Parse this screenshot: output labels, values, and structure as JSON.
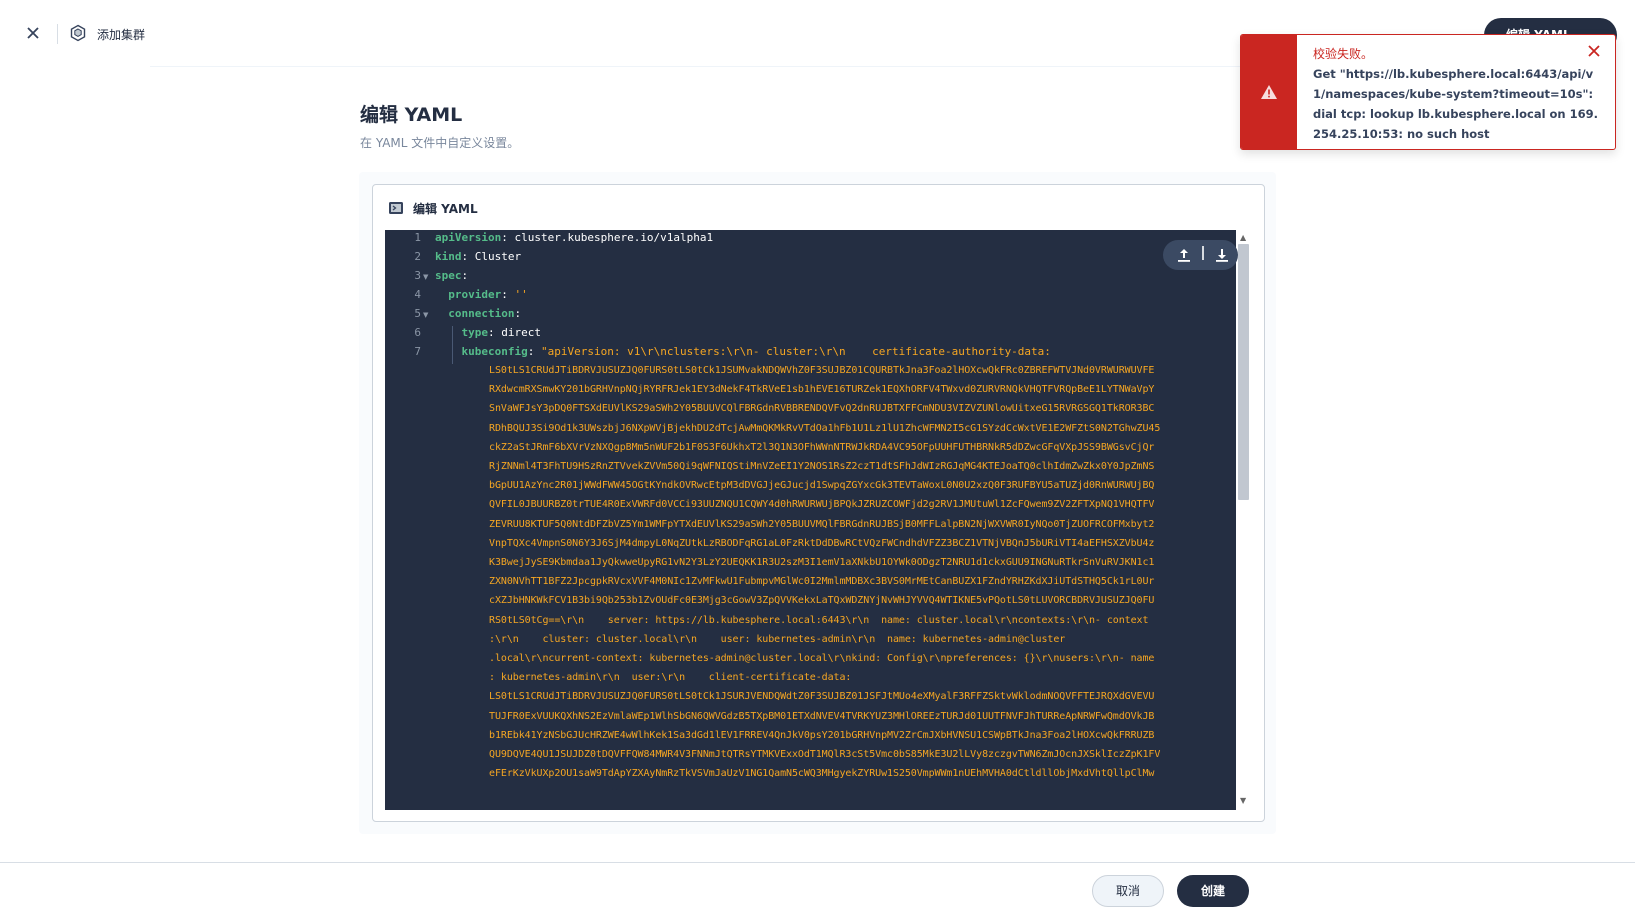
{
  "header": {
    "crumb": "添加集群",
    "edit_yaml_button": "编辑 YAML"
  },
  "page": {
    "title": "编辑 YAML",
    "subtitle": "在 YAML 文件中自定义设置。"
  },
  "editor": {
    "label": "编辑 YAML",
    "line_numbers": [
      "1",
      "2",
      "3",
      "4",
      "5",
      "6",
      "7"
    ],
    "lines": [
      {
        "key": "apiVersion",
        "sep": ": ",
        "val": "cluster.kubesphere.io/v1alpha1",
        "indent": ""
      },
      {
        "key": "kind",
        "sep": ": ",
        "val": "Cluster",
        "indent": ""
      },
      {
        "key": "spec",
        "sep": ":",
        "val": "",
        "indent": ""
      },
      {
        "key": "provider",
        "sep": ": ",
        "val": "''",
        "indent": "  "
      },
      {
        "key": "connection",
        "sep": ":",
        "val": "",
        "indent": "  "
      },
      {
        "key": "type",
        "sep": ": ",
        "val": "direct",
        "indent": "    "
      },
      {
        "key": "kubeconfig",
        "sep": ": ",
        "val": "\"apiVersion: v1\\r\\nclusters:\\r\\n- cluster:\\r\\n    certificate-authority-data:",
        "indent": "    "
      }
    ],
    "wrapped": [
      "LS0tLS1CRUdJTiBDRVJUSUZJQ0FURS0tLS0tCk1JSUMvakNDQWVhZ0F3SUJBZ01CQURBTkJna3Foa2lHOXcwQkFRc0ZBREFWTVJNd0VRWURWUVFE",
      "RXdwcmRXSmwKY201bGRHVnpNQjRYRFRJek1EY3dNekF4TkRVeE1sb1hEVE16TURZek1EQXhORFV4TWxvd0ZURVRNQkVHQTFVRQpBeE1LYTNWaVpY",
      "SnVaWFJsY3pDQ0FTSXdEUVlKS29aSWh2Y05BUUVCQlFBRGdnRVBBRENDQVFvQ2dnRUJBTXFFCmNDU3VIZVZUNlowUitxeG15RVRGSGQ1TkROR3BC",
      "RDhBQUJ3Si9Od1k3UWszbjJ6NXpWVjBjekhDU2dTcjAwMmQKMkRvVTdOa1hFb1U1Lz1lU1ZhcWFMN2I5cG1SYzdCcWxtVE1E2WFZtS0N2TGhwZU45",
      "ckZ2aStJRmF6bXVrVzNXQgpBMm5nWUF2b1F0S3F6UkhxT2l3Q1N3OFhWWnNTRWJkRDA4VC95OFpUUHFUTHBRNkR5dDZwcGFqVXpJSS9BWGsvCjQr",
      "RjZNNml4T3FhTU9HSzRnZTVvekZVVm50Qi9qWFNIQStiMnVZeEI1Y2NOS1RsZ2czT1dtSFhJdWIzRGJqMG4KTEJoaTQ0clhIdmZwZkx0Y0JpZmNS",
      "bGpUU1AzYnc2R01jWWdFWW45OGtKYndkOVRwcEtpM3dDVGJjeGJucjd1SwpqZGYxcGk3TEVTaWoxL0N0U2xzQ0F3RUFBYU5aTUZjd0RnWURWUjBQ",
      "QVFIL0JBUURBZ0trTUE4R0ExVWRFd0VCCi93UUZNQU1CQWY4d0hRWURWUjBPQkJZRUZCOWFjd2g2RV1JMUtuWl1ZcFQwem9ZV2ZFTXpNQ1VHQTFV",
      "ZEVRUU8KTUF5Q0NtdDFZbVZ5Ym1WMFpYTXdEUVlKS29aSWh2Y05BUUVMQlFBRGdnRUJBSjB0MFFLalpBN2NjWXVWR0IyNQo0TjZUOFRCOFMxbyt2",
      "VnpTQXc4VmpnS0N6Y3J6SjM4dmpyL0NqZUtkLzRBODFqRG1aL0FzRktDdDBwRCtVQzFWCndhdVFZZ3BCZ1VTNjVBQnJ5bURiVTI4aEFHSXZVbU4z",
      "K3BwejJySE9Kbmdaa1JyQkwweUpyRG1vN2Y3LzY2UEQKK1R3U2szM3I1emV1aXNkbU1OYWk0ODgzT2NRU1d1ckxGUU9INGNuRTkrSnVuRVJKN1c1",
      "ZXN0NVhTT1BFZ2JpcgpkRVcxVVF4M0NIc1ZvMFkwU1FubmpvMGlWc0I2MmlmMDBXc3BVS0MrMEtCanBUZX1FZndYRHZKdXJiUTdSTHQ5Ck1rL0Ur",
      "cXZJbHNKWkFCV1B3bi9Qb253b1ZvOUdFc0E3Mjg3cGowV3ZpQVVKekxLaTQxWDZNYjNvWHJYVVQ4WTIKNE5vPQotLS0tLUVORCBDRVJUSUZJQ0FU",
      "RS0tLS0tCg==\\r\\n    server: https://lb.kubesphere.local:6443\\r\\n  name: cluster.local\\r\\ncontexts:\\r\\n- context",
      ":\\r\\n    cluster: cluster.local\\r\\n    user: kubernetes-admin\\r\\n  name: kubernetes-admin@cluster",
      ".local\\r\\ncurrent-context: kubernetes-admin@cluster.local\\r\\nkind: Config\\r\\npreferences: {}\\r\\nusers:\\r\\n- name",
      ": kubernetes-admin\\r\\n  user:\\r\\n    client-certificate-data:",
      "LS0tLS1CRUdJTiBDRVJUSUZJQ0FURS0tLS0tCk1JSURJVENDQWdtZ0F3SUJBZ01JSFJtMUo4eXMyalF3RFFZSktvWklodmNOQVFFTEJRQXdGVEVU",
      "TUJFR0ExVUUKQXhNS2EzVmlaWEp1WlhSbGN6QWVGdzB5TXpBM01ETXdNVEV4TVRKYUZ3MHlOREEzTURJd01UUTFNVFJhTURReApNRWFwQmdOVkJB",
      "b1REbk41YzNSbGJUcHRZWE4wWlhKek1Sa3dGd1lEV1FRREV4QnJkV0psY201bGRHVnpMV2ZrCmJXbHVNSU1CSWpBTkJna3Foa2lHOXcwQkFRRUZB",
      "QU9DQVE4QU1JSUJDZ0tDQVFFQW84MWR4V3FNNmJtQTRsYTMKVExxOdT1MQlR3cSt5Vmc0bS85MkE3U2lLVy8zczgvTWN6ZmJOcnJXSklIczZpK1FV",
      "eFErKzVkUXp2OU1saW9TdApYZXAyNmRzTkVSVmJaUzV1NG1QamN5cWQ3MHgyekZYRUw1S250VmpWWm1nUEhMVHA0dCtldllObjMxdVhtQllpClMw"
    ]
  },
  "footer": {
    "cancel": "取消",
    "create": "创建"
  },
  "toast": {
    "title": "校验失败。",
    "message": "Get \"https://lb.kubesphere.local:6443/api/v1/namespaces/kube-system?timeout=10s\": dial tcp: lookup lb.kubesphere.local on 169.254.25.10:53: no such host"
  },
  "colors": {
    "primary_dark": "#242e42",
    "yaml_key": "#55bc8a",
    "yaml_string": "#f5a623",
    "error": "#ca2621"
  },
  "icons": [
    "close-icon",
    "cluster-icon",
    "yaml-file-icon",
    "upload-icon",
    "download-icon",
    "warning-icon",
    "toast-close-icon"
  ]
}
